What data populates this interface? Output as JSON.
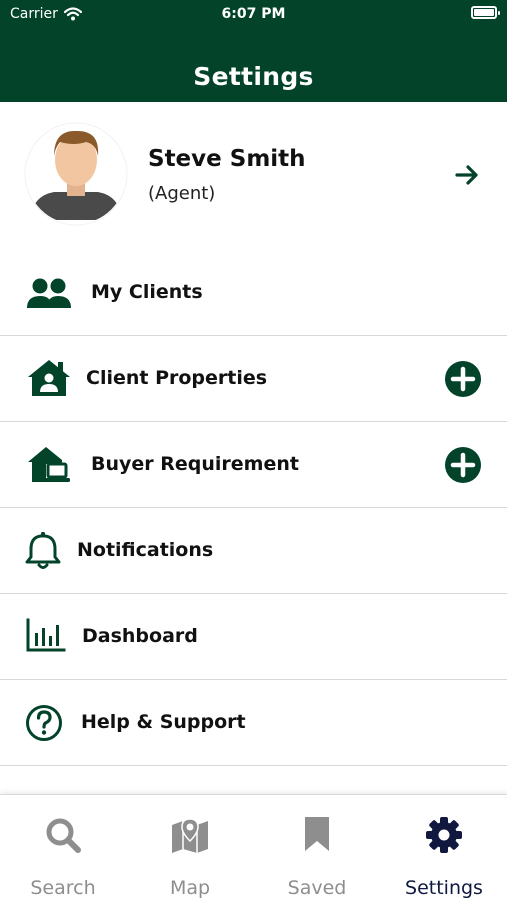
{
  "status_bar": {
    "carrier": "Carrier",
    "time": "6:07 PM"
  },
  "header": {
    "title": "Settings"
  },
  "profile": {
    "name": "Steve Smith",
    "role": "(Agent)"
  },
  "menu": {
    "items": [
      {
        "label": "My Clients",
        "icon": "users-icon"
      },
      {
        "label": "Client Properties",
        "icon": "house-user-icon",
        "action": "plus-circle-icon"
      },
      {
        "label": "Buyer Requirement",
        "icon": "house-laptop-icon",
        "action": "plus-circle-icon"
      },
      {
        "label": "Notifications",
        "icon": "bell-icon"
      },
      {
        "label": "Dashboard",
        "icon": "bar-chart-icon"
      },
      {
        "label": "Help & Support",
        "icon": "question-circle-icon"
      }
    ]
  },
  "tabs": [
    {
      "label": "Search",
      "icon": "search-icon",
      "active": false
    },
    {
      "label": "Map",
      "icon": "map-icon",
      "active": false
    },
    {
      "label": "Saved",
      "icon": "bookmark-icon",
      "active": false
    },
    {
      "label": "Settings",
      "icon": "gear-icon",
      "active": true
    }
  ],
  "colors": {
    "brand": "#02432a",
    "tab_active": "#10183f",
    "tab_inactive": "#8e8e8e"
  }
}
